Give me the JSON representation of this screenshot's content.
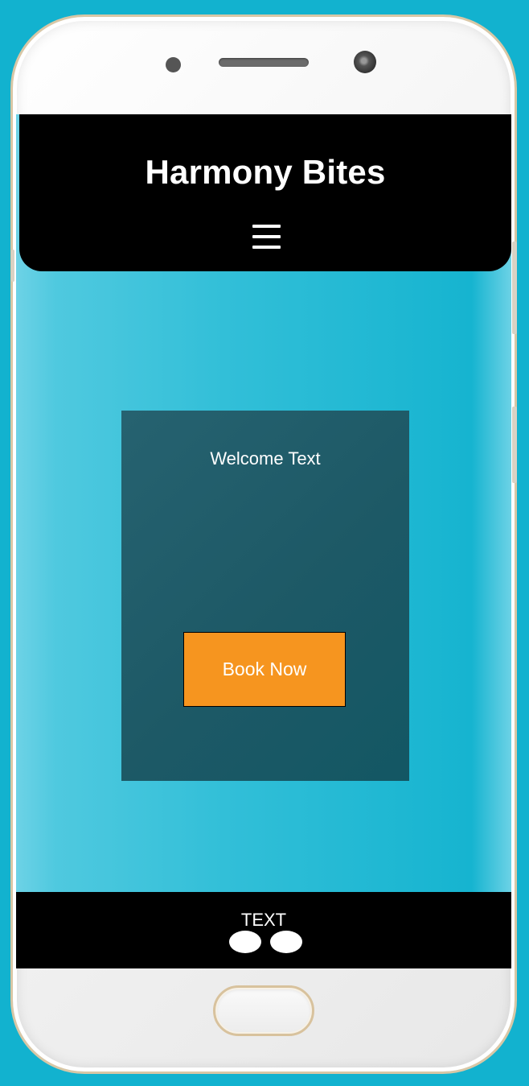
{
  "app": {
    "title": "Harmony Bites"
  },
  "header": {
    "menu_icon": "hamburger-menu-icon"
  },
  "hero": {
    "welcome_text": "Welcome Text",
    "book_button_label": "Book Now"
  },
  "footer": {
    "text": "TEXT",
    "dots": [
      "dot-1",
      "dot-2"
    ]
  },
  "colors": {
    "background": "#12b2cf",
    "header": "#000000",
    "card": "#1d5966",
    "button": "#f6951f",
    "text": "#ffffff"
  }
}
